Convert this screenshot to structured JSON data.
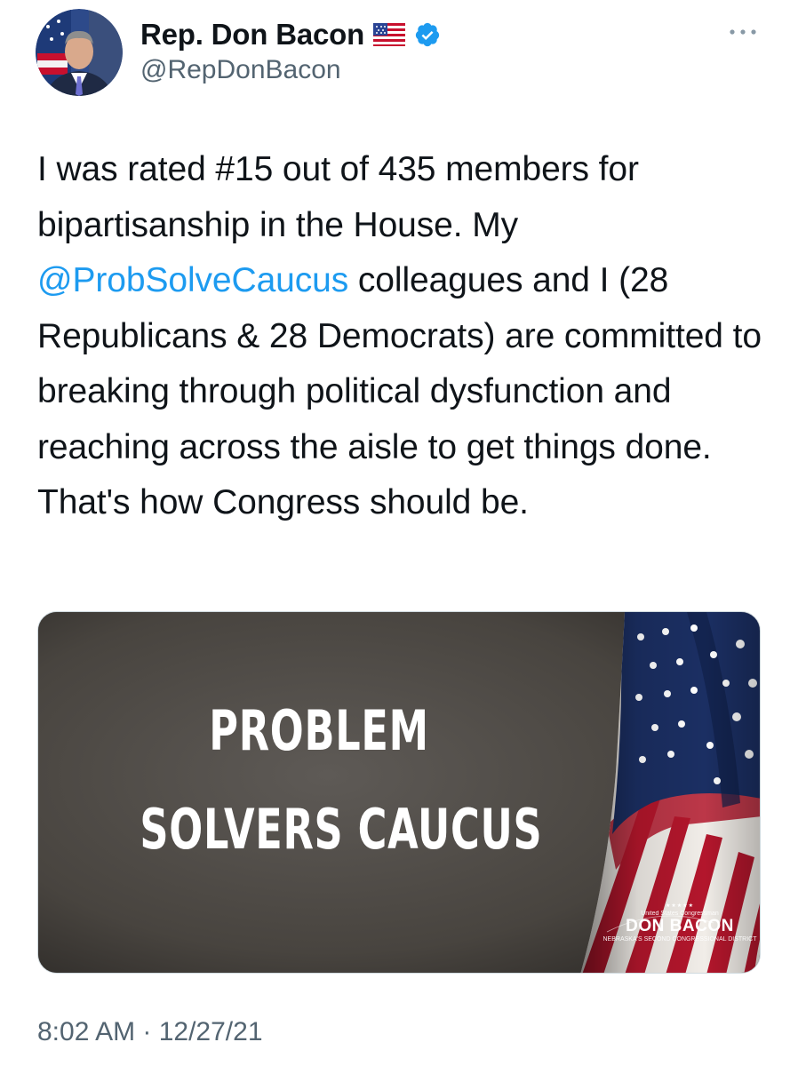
{
  "header": {
    "display_name": "Rep. Don Bacon",
    "flag_emoji": "🇺🇸",
    "handle": "@RepDonBacon",
    "verified_icon": "verified-badge-icon",
    "more_icon": "more-options-icon"
  },
  "tweet": {
    "text_before_mention": "I was rated #15 out of 435 members for bipartisanship in the House. My ",
    "mention": "@ProbSolveCaucus",
    "text_after_mention": " colleagues and I (28 Republicans & 28 Democrats) are committed to breaking through political dysfunction and reaching across the aisle to get things done. That's how Congress should be."
  },
  "media": {
    "headline_line1": "PROBLEM",
    "headline_line2": "SOLVERS CAUCUS",
    "logo_stars": "★★★★★",
    "logo_top": "United States Congressman",
    "logo_name": "DON BACON",
    "logo_bottom": "NEBRASKA'S SECOND CONGRESSIONAL DISTRICT"
  },
  "footer": {
    "timestamp": "8:02 AM · 12/27/21"
  },
  "colors": {
    "link": "#1d9bf0",
    "secondary_text": "#536471",
    "verified": "#1d9bf0"
  }
}
